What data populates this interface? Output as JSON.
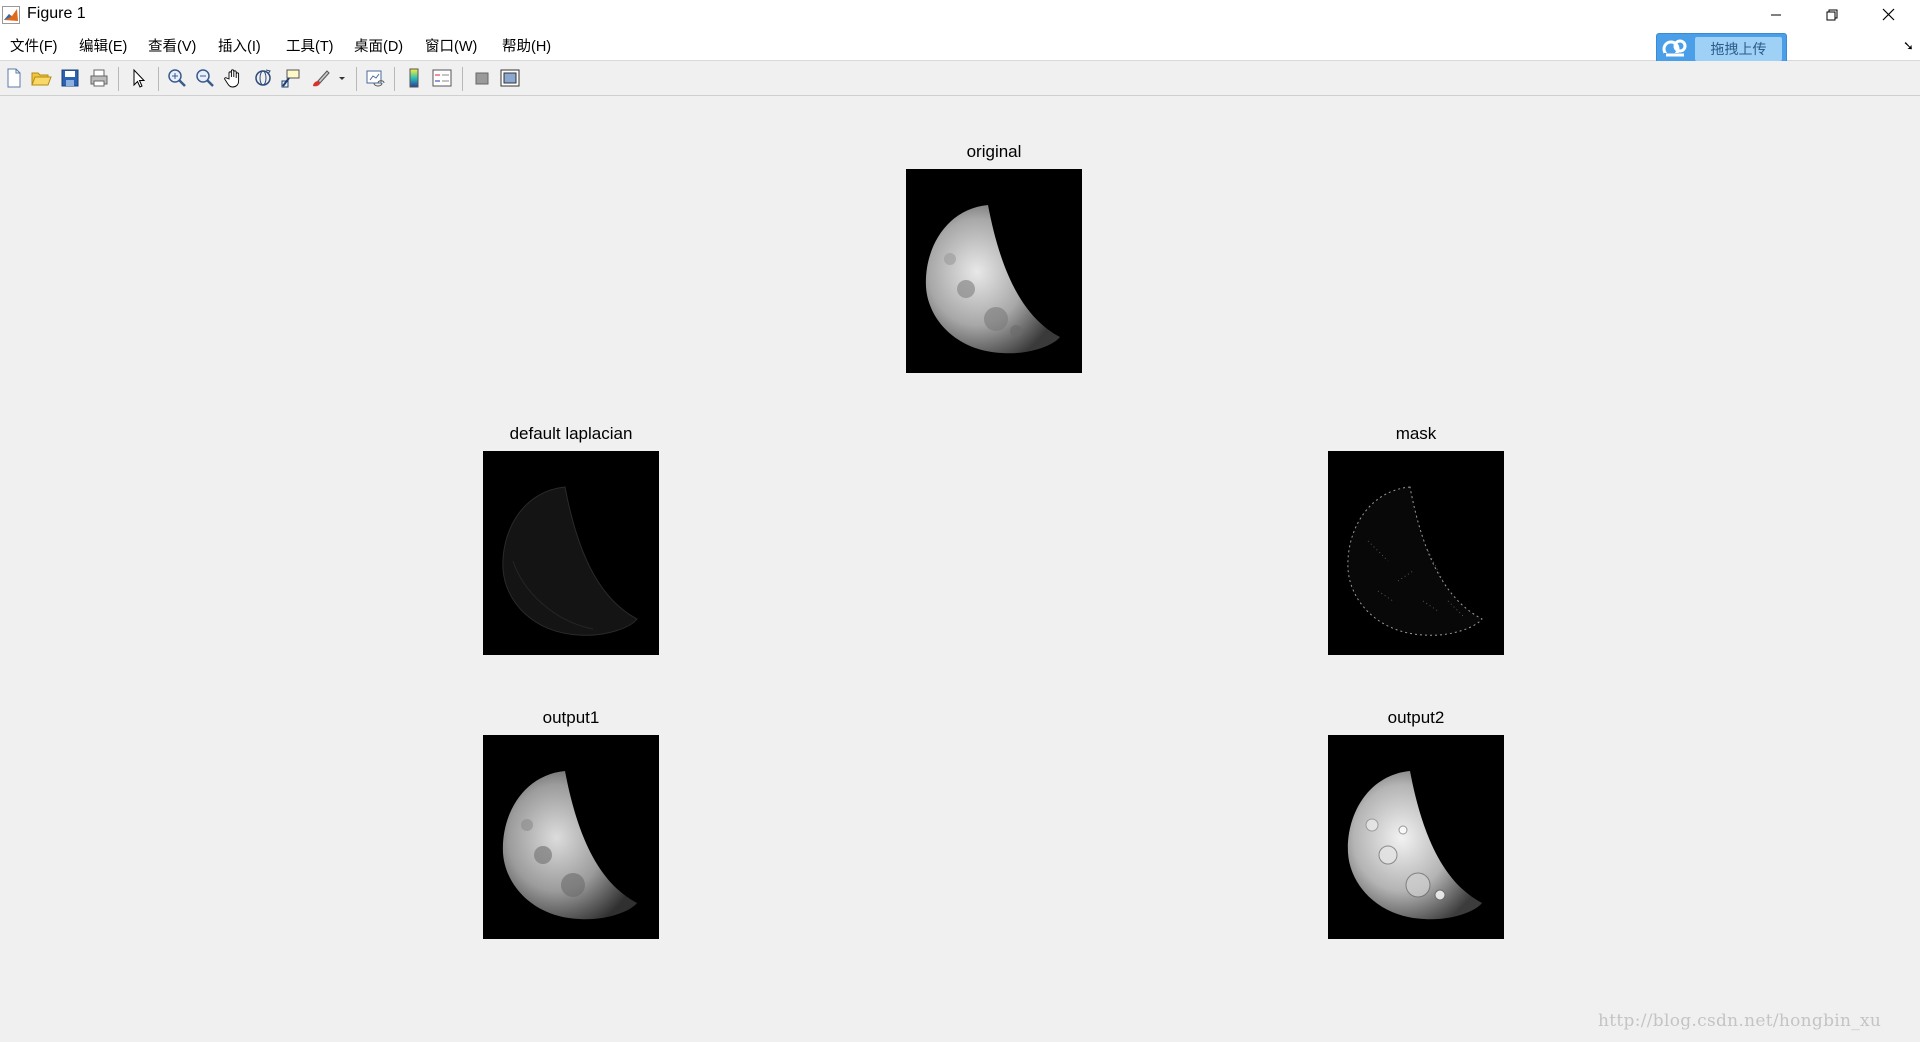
{
  "window": {
    "title": "Figure 1",
    "controls": {
      "minimize": "minimize-icon",
      "restore": "restore-icon",
      "close": "close-icon"
    }
  },
  "menu": {
    "items": [
      "文件(F)",
      "编辑(E)",
      "查看(V)",
      "插入(I)",
      "工具(T)",
      "桌面(D)",
      "窗口(W)",
      "帮助(H)"
    ],
    "upload_button": "拖拽上传"
  },
  "toolbar": {
    "buttons": [
      "new-figure-icon",
      "open-file-icon",
      "save-icon",
      "print-icon",
      "edit-plot-icon",
      "zoom-in-icon",
      "zoom-out-icon",
      "pan-icon",
      "rotate-3d-icon",
      "data-cursor-icon",
      "brush-icon",
      "link-plot-icon",
      "insert-colorbar-icon",
      "insert-legend-icon",
      "hide-plot-tools-icon",
      "show-plot-tools-icon"
    ]
  },
  "figure": {
    "subplots": [
      {
        "title": "original"
      },
      {
        "title": "default laplacian"
      },
      {
        "title": "mask"
      },
      {
        "title": "output1"
      },
      {
        "title": "output2"
      }
    ]
  },
  "watermark": "http://blog.csdn.net/hongbin_xu",
  "colors": {
    "titlebar": "#ffffff",
    "menubar": "#ffffff",
    "figure_background": "#f0f0f0",
    "image_background": "#000000",
    "upload_button": "#4a9fe8"
  }
}
